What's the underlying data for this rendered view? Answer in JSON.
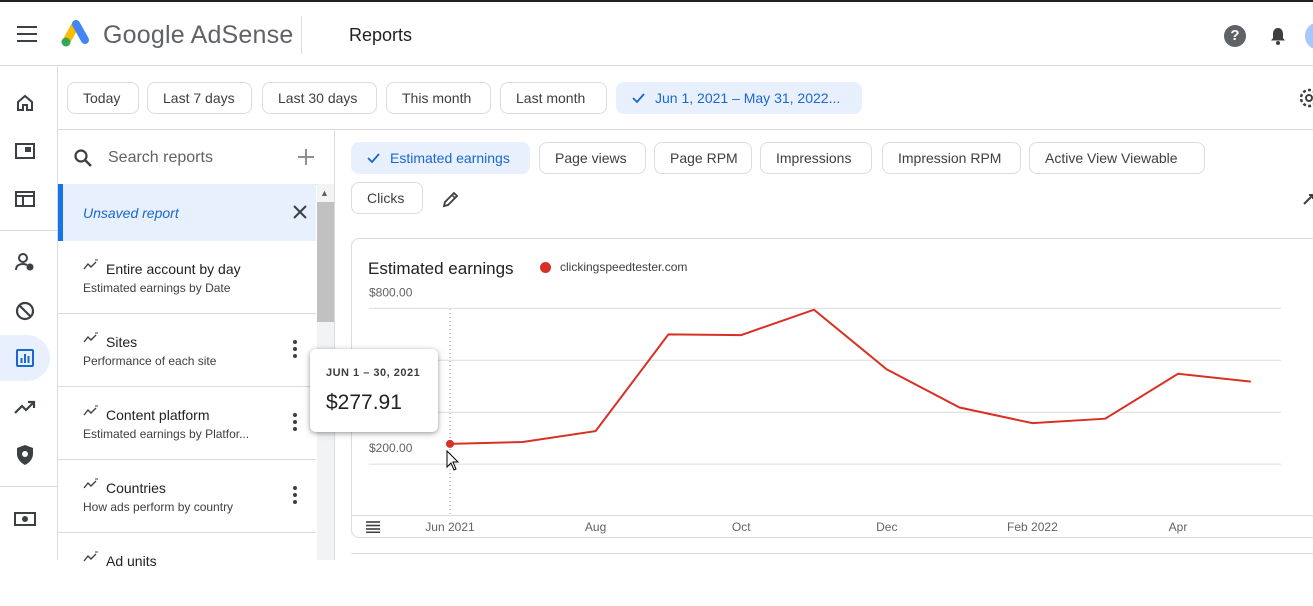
{
  "header": {
    "brand": "Google AdSense",
    "page_title": "Reports",
    "help_label": "?"
  },
  "date_chips": [
    {
      "label": "Today",
      "selected": false
    },
    {
      "label": "Last 7 days",
      "selected": false
    },
    {
      "label": "Last 30 days",
      "selected": false
    },
    {
      "label": "This month",
      "selected": false
    },
    {
      "label": "Last month",
      "selected": false
    },
    {
      "label": "Jun 1, 2021 – May 31, 2022...",
      "selected": true
    }
  ],
  "sidebar": {
    "search_placeholder": "Search reports",
    "unsaved_report": "Unsaved report",
    "reports": [
      {
        "name": "Entire account by day",
        "description": "Estimated earnings by Date"
      },
      {
        "name": "Sites",
        "description": "Performance of each site"
      },
      {
        "name": "Content platform",
        "description": "Estimated earnings by Platfor..."
      },
      {
        "name": "Countries",
        "description": "How ads perform by country"
      },
      {
        "name": "Ad units",
        "description": ""
      }
    ]
  },
  "metrics": [
    {
      "label": "Estimated earnings",
      "selected": true
    },
    {
      "label": "Page views",
      "selected": false
    },
    {
      "label": "Page RPM",
      "selected": false
    },
    {
      "label": "Impressions",
      "selected": false
    },
    {
      "label": "Impression RPM",
      "selected": false
    },
    {
      "label": "Active View Viewable",
      "selected": false
    },
    {
      "label": "Clicks",
      "selected": false
    }
  ],
  "tooltip": {
    "date": "JUN 1 – 30, 2021",
    "value": "$277.91"
  },
  "colors": {
    "accent": "#1a73e8",
    "selected_bg": "#e8f0fe",
    "series": "#d93025"
  },
  "chart_data": {
    "type": "line",
    "title": "Estimated earnings",
    "series": [
      {
        "name": "clickingspeedtester.com",
        "values": [
          277.91,
          285,
          327,
          700,
          697,
          795,
          565,
          418,
          358,
          375,
          548,
          518
        ]
      }
    ],
    "x": [
      "2021-06",
      "2021-07",
      "2021-08",
      "2021-09",
      "2021-10",
      "2021-11",
      "2021-12",
      "2022-01",
      "2022-02",
      "2022-03",
      "2022-04",
      "2022-05"
    ],
    "x_tick_labels": [
      "Jun 2021",
      "Aug",
      "Oct",
      "Dec",
      "Feb 2022",
      "Apr"
    ],
    "y_tick_labels": [
      "$800.00",
      "$200.00"
    ],
    "ylim": [
      0,
      1000
    ],
    "grid": true,
    "legend": "top-left"
  }
}
